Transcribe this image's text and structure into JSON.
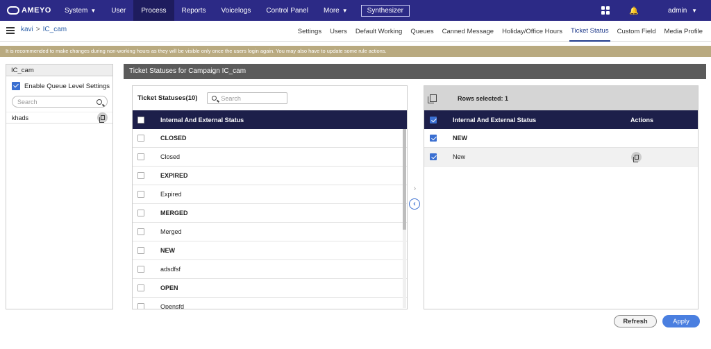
{
  "topnav": {
    "logo_text": "AMEYO",
    "items": [
      {
        "label": "System",
        "chevron": true
      },
      {
        "label": "User",
        "chevron": false
      },
      {
        "label": "Process",
        "chevron": false
      },
      {
        "label": "Reports",
        "chevron": false
      },
      {
        "label": "Voicelogs",
        "chevron": false
      },
      {
        "label": "Control Panel",
        "chevron": false
      },
      {
        "label": "More",
        "chevron": true
      }
    ],
    "active_item": "Process",
    "synthesizer_label": "Synthesizer",
    "admin_label": "admin",
    "icons": [
      "apps-grid-icon",
      "bell-icon",
      "chevron-down-icon"
    ],
    "bar_color": "#2c2a86"
  },
  "breadcrumb": {
    "root": "kavi",
    "separator": ">",
    "current": "IC_cam"
  },
  "tabs": [
    "Settings",
    "Users",
    "Default Working",
    "Queues",
    "Canned Message",
    "Holiday/Office Hours",
    "Ticket Status",
    "Custom Field",
    "Media Profile"
  ],
  "active_tab": "Ticket Status",
  "banner": {
    "text": "It is recommended to make changes during non-working hours as they will be visible only once the users login again. You may also have to update some rule actions.",
    "color": "#b9aa80"
  },
  "left_panel": {
    "title": "IC_cam",
    "enable_label": "Enable Queue Level Settings",
    "enable_checked": true,
    "search_placeholder": "Search",
    "items": [
      "khads"
    ]
  },
  "section_title": "Ticket Statuses for Campaign IC_cam",
  "statuses_table": {
    "title": "Ticket Statuses(10)",
    "search_placeholder": "Search",
    "column_header": "Internal And External Status",
    "rows": [
      {
        "label": "CLOSED",
        "bold": true
      },
      {
        "label": "Closed",
        "bold": false
      },
      {
        "label": "EXPIRED",
        "bold": true
      },
      {
        "label": "Expired",
        "bold": false
      },
      {
        "label": "MERGED",
        "bold": true
      },
      {
        "label": "Merged",
        "bold": false
      },
      {
        "label": "NEW",
        "bold": true
      },
      {
        "label": "adsdfsf",
        "bold": false
      },
      {
        "label": "OPEN",
        "bold": true
      },
      {
        "label": "Opensfd",
        "bold": false
      }
    ]
  },
  "selected_table": {
    "rows_selected_label": "Rows selected: 1",
    "column_header": "Internal And External Status",
    "actions_header": "Actions",
    "rows": [
      {
        "label": "NEW",
        "bold": true,
        "checked": true
      },
      {
        "label": "New",
        "bold": false,
        "checked": true
      }
    ]
  },
  "buttons": {
    "refresh": "Refresh",
    "apply": "Apply"
  },
  "transfer_arrows": {
    "right": "›",
    "left": "‹"
  }
}
